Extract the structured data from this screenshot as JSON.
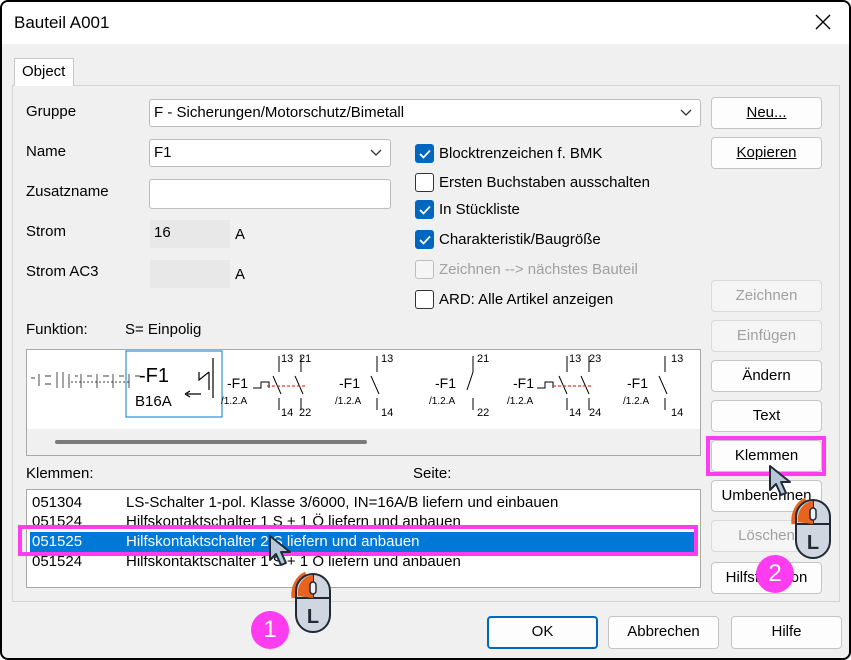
{
  "window": {
    "title": "Bauteil A001"
  },
  "tabs": [
    {
      "label": "Object"
    }
  ],
  "form": {
    "gruppe_label": "Gruppe",
    "gruppe_value": "F - Sicherungen/Motorschutz/Bimetall",
    "name_label": "Name",
    "name_value": "F1",
    "zusatzname_label": "Zusatzname",
    "zusatzname_value": "",
    "strom_label": "Strom",
    "strom_value": "16",
    "strom_unit": "A",
    "strom_ac3_label": "Strom AC3",
    "strom_ac3_value": "",
    "strom_ac3_unit": "A",
    "funktion_label": "Funktion:",
    "funktion_value": "S= Einpolig"
  },
  "checkboxes": [
    {
      "label": "Blocktrenzeichen f. BMK",
      "checked": true,
      "disabled": false
    },
    {
      "label": "Ersten Buchstaben ausschalten",
      "checked": false,
      "disabled": false
    },
    {
      "label": "In Stückliste",
      "checked": true,
      "disabled": false
    },
    {
      "label": "Charakteristik/Baugröße",
      "checked": true,
      "disabled": false
    },
    {
      "label": "Zeichnen --> nächstes Bauteil",
      "checked": false,
      "disabled": true
    },
    {
      "label": "ARD: Alle Artikel anzeigen",
      "checked": false,
      "disabled": false
    }
  ],
  "buttons": {
    "neu": "Neu...",
    "kopieren": "Kopieren",
    "zeichnen": "Zeichnen",
    "einfuegen": "Einfügen",
    "aendern": "Ändern",
    "text": "Text",
    "klemmen": "Klemmen",
    "umbenennen": "Umbenennen",
    "loeschen": "Löschen",
    "hilfsfunktion": "Hilfsfunktion",
    "ok": "OK",
    "abbrechen": "Abbrechen",
    "hilfe": "Hilfe"
  },
  "symbols": {
    "main_ref": "-F1",
    "main_sub": "B16A",
    "ref": "-F1",
    "page_ref": "/1.2.A",
    "contacts": [
      {
        "top": "13",
        "top2": "21",
        "bottom": "14",
        "bottom2": "22"
      },
      {
        "top": "13",
        "bottom": "14"
      },
      {
        "top": "21",
        "bottom": "22"
      },
      {
        "top": "13",
        "top2": "23",
        "bottom": "14",
        "bottom2": "24"
      },
      {
        "top": "13",
        "bottom": "14"
      }
    ]
  },
  "klemmen_list": {
    "header_left": "Klemmen:",
    "header_right": "Seite:",
    "rows": [
      {
        "code": "051304",
        "desc": "LS-Schalter 1-pol. Klasse 3/6000, IN=16A/B liefern und einbauen",
        "selected": false
      },
      {
        "code": "051524",
        "desc": "Hilfskontaktschalter 1 S + 1 Ö liefern und anbauen",
        "selected": false
      },
      {
        "code": "051525",
        "desc": "Hilfskontaktschalter 2 S liefern und anbauen",
        "selected": true
      },
      {
        "code": "051524",
        "desc": "Hilfskontaktschalter 1 S + 1 Ö liefern und anbauen",
        "selected": false
      }
    ]
  },
  "annotations": {
    "step1": "1",
    "step2": "2",
    "mouse_button": "L",
    "highlight_color": "#ff3cf0",
    "mouse_accent": "#e8641e"
  },
  "colors": {
    "accent": "#0067c0",
    "selection": "#0078d7"
  }
}
